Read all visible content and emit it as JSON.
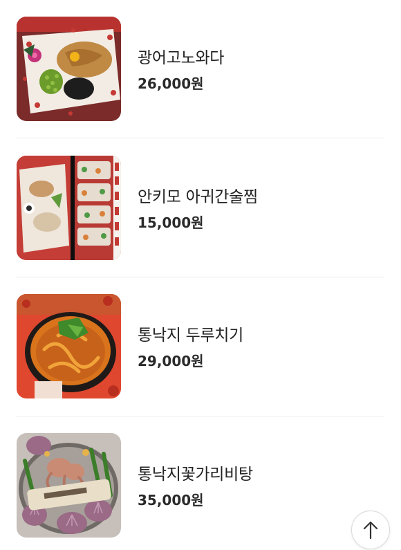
{
  "menu": {
    "items": [
      {
        "name": "광어고노와다",
        "price": "26,000원",
        "image_icon": "dish-photo-raw-fish-konowata"
      },
      {
        "name": "안키모 아귀간술찜",
        "price": "15,000원",
        "image_icon": "dish-photo-monkfish-liver"
      },
      {
        "name": "통낙지 두루치기",
        "price": "29,000원",
        "image_icon": "dish-photo-octopus-stir-fry"
      },
      {
        "name": "통낙지꽃가리비탕",
        "price": "35,000원",
        "image_icon": "dish-photo-octopus-scallop-soup"
      }
    ]
  },
  "scroll_top_button": {
    "icon": "arrow-up-icon"
  },
  "colors": {
    "text": "#222222",
    "divider": "#ececec",
    "button_border": "#d9d9d9"
  }
}
